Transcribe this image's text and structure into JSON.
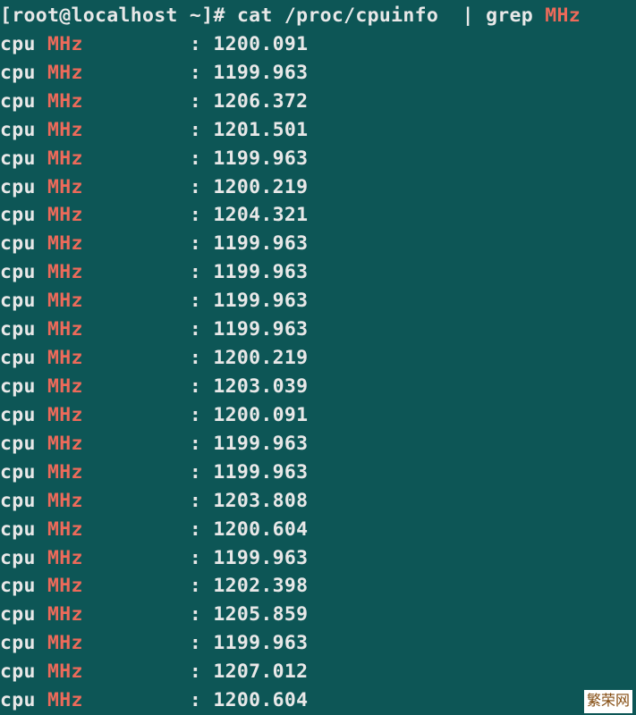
{
  "prompt": {
    "open_bracket": "[",
    "user": "root",
    "at": "@",
    "host": "localhost",
    "space_tilde": " ~",
    "close_bracket": "]",
    "hash": "# ",
    "cmd_part1": "cat /proc/cpuinfo  | grep ",
    "cmd_highlight": "MHz"
  },
  "output": {
    "field_label": "cpu ",
    "mhz_label": "MHz",
    "separator": "         : ",
    "rows": [
      {
        "value": "1200.091"
      },
      {
        "value": "1199.963"
      },
      {
        "value": "1206.372"
      },
      {
        "value": "1201.501"
      },
      {
        "value": "1199.963"
      },
      {
        "value": "1200.219"
      },
      {
        "value": "1204.321"
      },
      {
        "value": "1199.963"
      },
      {
        "value": "1199.963"
      },
      {
        "value": "1199.963"
      },
      {
        "value": "1199.963"
      },
      {
        "value": "1200.219"
      },
      {
        "value": "1203.039"
      },
      {
        "value": "1200.091"
      },
      {
        "value": "1199.963"
      },
      {
        "value": "1199.963"
      },
      {
        "value": "1203.808"
      },
      {
        "value": "1200.604"
      },
      {
        "value": "1199.963"
      },
      {
        "value": "1202.398"
      },
      {
        "value": "1205.859"
      },
      {
        "value": "1199.963"
      },
      {
        "value": "1207.012"
      },
      {
        "value": "1200.604"
      }
    ]
  },
  "watermark": "繁荣网"
}
